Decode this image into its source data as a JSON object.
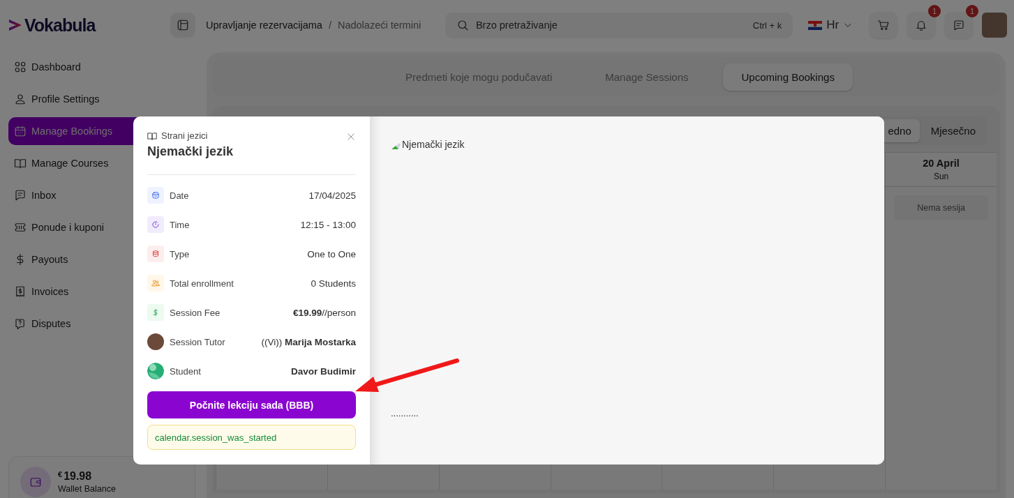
{
  "header": {
    "logo": "Vokabula",
    "breadcrumb": [
      "Upravljanje rezervacijama",
      "Nadolazeći termini"
    ],
    "breadcrumb_separator": "/",
    "search": {
      "placeholder": "Brzo pretraživanje",
      "shortcut": "Ctrl + k"
    },
    "language": "Hr",
    "notifications_badge": "1",
    "messages_badge": "1"
  },
  "sidebar": {
    "items": [
      {
        "label": "Dashboard",
        "selected": false
      },
      {
        "label": "Profile Settings",
        "selected": false
      },
      {
        "label": "Manage Bookings",
        "selected": true
      },
      {
        "label": "Manage Courses",
        "selected": false
      },
      {
        "label": "Inbox",
        "selected": false
      },
      {
        "label": "Ponude i kuponi",
        "selected": false
      },
      {
        "label": "Payouts",
        "selected": false
      },
      {
        "label": "Invoices",
        "selected": false
      },
      {
        "label": "Disputes",
        "selected": false
      }
    ],
    "wallet": {
      "currency": "€",
      "amount": "19.98",
      "label": "Wallet Balance"
    }
  },
  "tabs": [
    {
      "label": "Predmeti koje mogu podučavati",
      "selected": false
    },
    {
      "label": "Manage Sessions",
      "selected": false
    },
    {
      "label": "Upcoming Bookings",
      "selected": true
    }
  ],
  "calendar": {
    "view_toggle": [
      {
        "label": "edno",
        "selected": true
      },
      {
        "label": "Mjesečno",
        "selected": false
      }
    ],
    "day_header": {
      "date": "20 April",
      "weekday": "Sun"
    },
    "empty_label": "Nema sesija"
  },
  "modal": {
    "category": "Strani jezici",
    "title": "Njemački jezik",
    "details": [
      {
        "kind": "date",
        "label": "Date",
        "value": "17/04/2025"
      },
      {
        "kind": "time",
        "label": "Time",
        "value": "12:15 - 13:00"
      },
      {
        "kind": "type",
        "label": "Type",
        "value": "One to One"
      },
      {
        "kind": "enrollment",
        "label": "Total enrollment",
        "value": "0 Students"
      },
      {
        "kind": "fee",
        "label": "Session Fee",
        "value": "**€19.99**//person"
      },
      {
        "kind": "tutor",
        "label": "Session Tutor",
        "value": "((Vi)) **Marija Mostarka**"
      },
      {
        "kind": "student",
        "label": "Student",
        "value": "**Davor Budimir**"
      }
    ],
    "start_button": "Počnite lekciju sada (BBB)",
    "status_message": "calendar.session_was_started",
    "image_alt": "Njemački jezik",
    "placeholder_dots": "..........."
  }
}
